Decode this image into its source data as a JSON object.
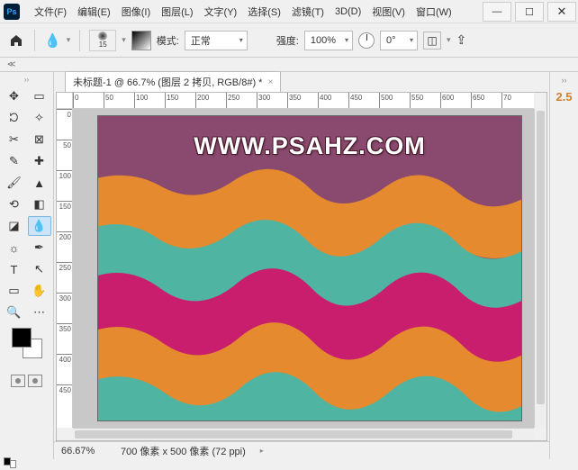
{
  "menu": {
    "items": [
      "文件(F)",
      "编辑(E)",
      "图像(I)",
      "图层(L)",
      "文字(Y)",
      "选择(S)",
      "滤镜(T)",
      "3D(D)",
      "视图(V)",
      "窗口(W)"
    ]
  },
  "options": {
    "brush_size": "15",
    "mode_label": "模式:",
    "mode_value": "正常",
    "strength_label": "强度:",
    "strength_value": "100%",
    "angle_value": "0°"
  },
  "document": {
    "tab_title": "未标题-1 @ 66.7% (图层 2 拷贝, RGB/8#) *",
    "watermark": "WWW.PSAHZ.COM"
  },
  "ruler_h": [
    "0",
    "50",
    "100",
    "150",
    "200",
    "250",
    "300",
    "350",
    "400",
    "450",
    "500",
    "550",
    "600",
    "650",
    "70"
  ],
  "ruler_v": [
    "0",
    "50",
    "100",
    "150",
    "200",
    "250",
    "300",
    "350",
    "400",
    "450"
  ],
  "status": {
    "zoom": "66.67%",
    "dims": "700 像素 x 500 像素 (72 ppi)"
  },
  "right_panel": {
    "value": "2.5"
  },
  "tools": [
    [
      "move",
      "✥"
    ],
    [
      "artboard",
      "▭"
    ],
    [
      "lasso",
      "ᘏ"
    ],
    [
      "magic-wand",
      "✧"
    ],
    [
      "crop",
      "✂"
    ],
    [
      "frame",
      "⊠"
    ],
    [
      "eyedropper",
      "✎"
    ],
    [
      "heal",
      "✚"
    ],
    [
      "brush",
      "🖌"
    ],
    [
      "stamp",
      "▲"
    ],
    [
      "history",
      "⟲"
    ],
    [
      "eraser",
      "◧"
    ],
    [
      "gradient",
      "◪"
    ],
    [
      "blur",
      "💧"
    ],
    [
      "dodge",
      "☼"
    ],
    [
      "pen",
      "✒"
    ],
    [
      "type",
      "T"
    ],
    [
      "path",
      "↖"
    ],
    [
      "rect",
      "▭"
    ],
    [
      "hand",
      "✋"
    ],
    [
      "zoom",
      "🔍"
    ],
    [
      "",
      ""
    ]
  ],
  "colors": {
    "purple": "#8a4a6f",
    "magenta": "#c91e6e",
    "orange": "#e58a2e",
    "teal": "#4fb5a2"
  }
}
